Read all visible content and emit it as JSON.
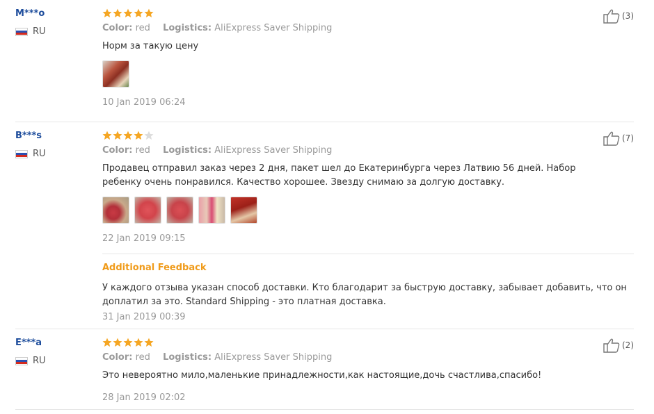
{
  "labels": {
    "color": "Color:",
    "logistics": "Logistics:",
    "additional": "Additional Feedback"
  },
  "reviews": [
    {
      "user": "M***o",
      "country": "RU",
      "rating": 5,
      "color": "red",
      "logistics": "AliExpress Saver Shipping",
      "text": "Норм за такую цену",
      "photo_count": 1,
      "date": "10 Jan 2019 06:24",
      "helpful": "(3)"
    },
    {
      "user": "B***s",
      "country": "RU",
      "rating": 4,
      "color": "red",
      "logistics": "AliExpress Saver Shipping",
      "text": "Продавец отправил заказ через 2 дня, пакет шел до Екатеринбурга через Латвию 56 дней. Набор ребенку очень понравился. Качество хорошее. Звезду снимаю за долгую доставку.",
      "photo_count": 5,
      "date": "22 Jan 2019 09:15",
      "helpful": "(7)",
      "additional_text": "У каждого отзыва указан способ доставки. Кто благодарит за быструю доставку, забывает добавить, что он доплатил за это. Standard Shipping - это платная доставка.",
      "additional_date": "31 Jan 2019 00:39"
    },
    {
      "user": "E***a",
      "country": "RU",
      "rating": 5,
      "color": "red",
      "logistics": "AliExpress Saver Shipping",
      "text": "Это невероятно мило,маленькие принадлежности,как настоящие,дочь счастлива,спасибо!",
      "photo_count": 0,
      "date": "28 Jan 2019 02:02",
      "helpful": "(2)"
    }
  ],
  "colors": {
    "star_on": "#f5a623",
    "star_off": "#dddddd",
    "username": "#1e4d9c",
    "accent": "#f09b1a"
  }
}
